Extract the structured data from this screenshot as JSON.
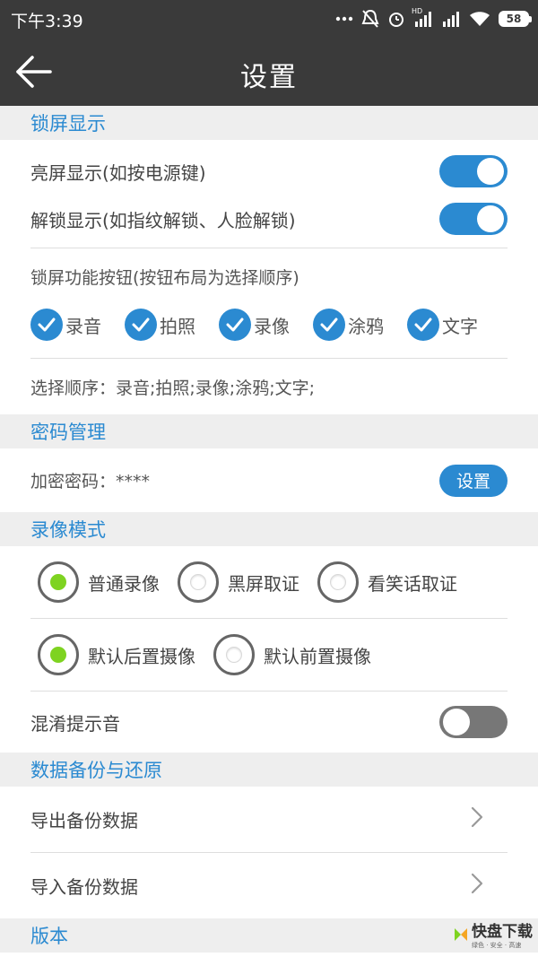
{
  "status_bar": {
    "time": "下午3:39",
    "network_label": "HD",
    "battery": "58",
    "icons": [
      "dots-icon",
      "bell-off-icon",
      "alarm-icon",
      "signal-icon",
      "signal-icon",
      "wifi-icon",
      "battery-icon"
    ]
  },
  "app_bar": {
    "title": "设置",
    "back_icon": "back-arrow-icon"
  },
  "sections": {
    "lock_screen": {
      "header": "锁屏显示",
      "bright_screen_label": "亮屏显示(如按电源键)",
      "bright_screen_on": true,
      "unlock_label": "解锁显示(如指纹解锁、人脸解锁)",
      "unlock_on": true,
      "buttons_label": "锁屏功能按钮(按钮布局为选择顺序)",
      "buttons": [
        "录音",
        "拍照",
        "录像",
        "涂鸦",
        "文字"
      ],
      "order_text": "选择顺序：录音;拍照;录像;涂鸦;文字;"
    },
    "password": {
      "header": "密码管理",
      "label": "加密密码：****",
      "button": "设置"
    },
    "video_mode": {
      "header": "录像模式",
      "mode_options": [
        "普通录像",
        "黑屏取证",
        "看笑话取证"
      ],
      "mode_selected": 0,
      "camera_options": [
        "默认后置摄像",
        "默认前置摄像"
      ],
      "camera_selected": 0,
      "confuse_label": "混淆提示音",
      "confuse_on": false
    },
    "backup": {
      "header": "数据备份与还原",
      "export_label": "导出备份数据",
      "import_label": "导入备份数据"
    },
    "version": {
      "header": "版本"
    }
  },
  "watermark": {
    "text": "快盘下载",
    "sub": "绿色 · 安全 · 高速"
  },
  "colors": {
    "accent": "#2b8ad1",
    "bar": "#3a3a3a",
    "radio_selected": "#7ed321",
    "section_bg": "#eeeeee"
  }
}
